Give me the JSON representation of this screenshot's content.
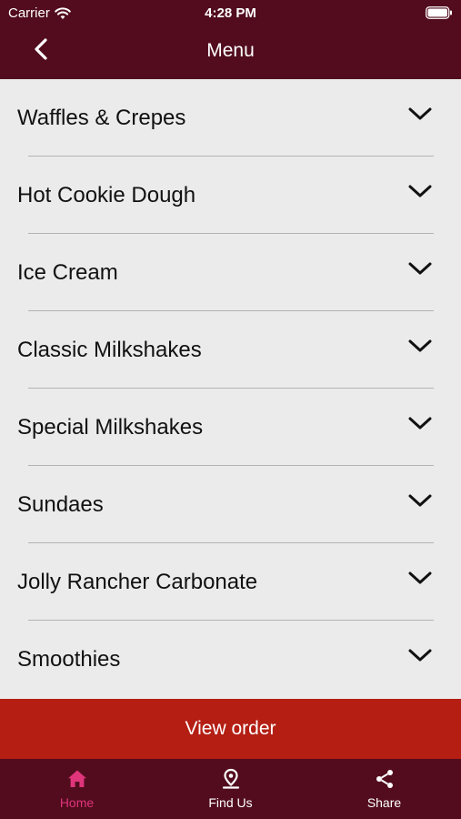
{
  "status_bar": {
    "carrier": "Carrier",
    "time": "4:28 PM",
    "icons": [
      "wifi-icon",
      "battery-icon"
    ]
  },
  "nav": {
    "title": "Menu",
    "back_icon": "chevron-left-icon"
  },
  "categories": [
    {
      "label": "Waffles & Crepes"
    },
    {
      "label": "Hot Cookie Dough"
    },
    {
      "label": "Ice Cream"
    },
    {
      "label": "Classic Milkshakes"
    },
    {
      "label": "Special Milkshakes"
    },
    {
      "label": "Sundaes"
    },
    {
      "label": "Jolly Rancher Carbonate"
    },
    {
      "label": "Smoothies"
    }
  ],
  "order_button": {
    "label": "View order"
  },
  "tabs": [
    {
      "label": "Home",
      "icon": "home-icon",
      "active": true
    },
    {
      "label": "Find Us",
      "icon": "map-pin-icon",
      "active": false
    },
    {
      "label": "Share",
      "icon": "share-icon",
      "active": false
    }
  ],
  "colors": {
    "header": "#520c1e",
    "button": "#b41e13",
    "active_tab": "#e0347b",
    "list_bg": "#ebebeb"
  }
}
